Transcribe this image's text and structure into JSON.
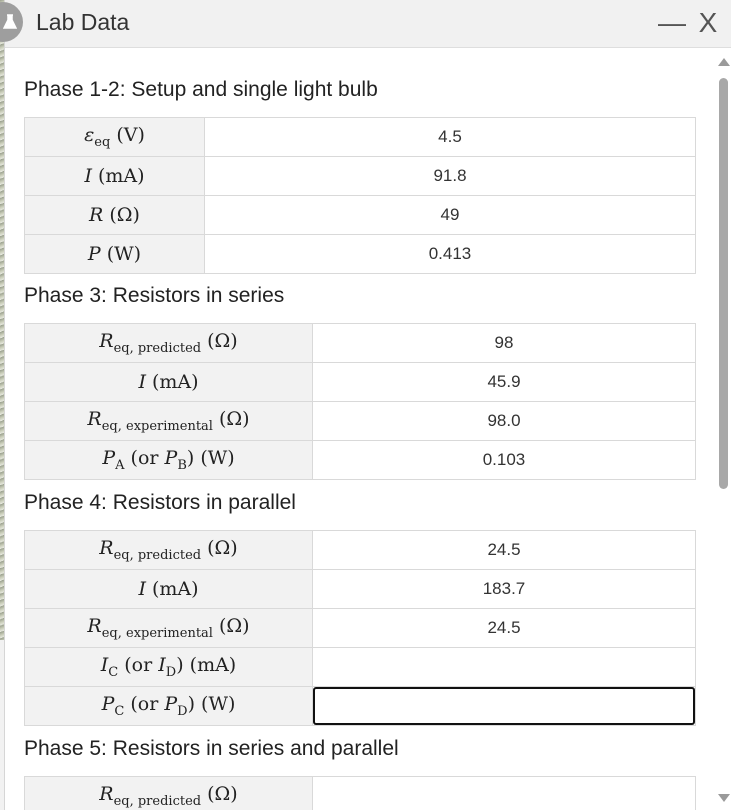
{
  "window": {
    "title": "Lab Data",
    "minimize_label": "—",
    "close_label": "X"
  },
  "sections": [
    {
      "title": "Phase 1-2: Setup and single light bulb",
      "rows": [
        {
          "label_main": "ε",
          "label_sub": "eq",
          "label_unit": " (V)",
          "value": "4.5"
        },
        {
          "label_main": "I",
          "label_sub": "",
          "label_unit": " (mA)",
          "value": "91.8"
        },
        {
          "label_main": "R",
          "label_sub": "",
          "label_unit": " (Ω)",
          "value": "49"
        },
        {
          "label_main": "P",
          "label_sub": "",
          "label_unit": " (W)",
          "value": "0.413"
        }
      ]
    },
    {
      "title": "Phase 3: Resistors in series",
      "rows": [
        {
          "label_main": "R",
          "label_sub": "eq, predicted",
          "label_unit": " (Ω)",
          "value": "98"
        },
        {
          "label_main": "I",
          "label_sub": "",
          "label_unit": " (mA)",
          "value": "45.9"
        },
        {
          "label_main": "R",
          "label_sub": "eq, experimental",
          "label_unit": " (Ω)",
          "value": "98.0"
        },
        {
          "label_main": "P",
          "label_sub": "A",
          "label_mid": " (or ",
          "label_main2": "P",
          "label_sub2": "B",
          "label_unit": ") (W)",
          "value": "0.103"
        }
      ]
    },
    {
      "title": "Phase 4: Resistors in parallel",
      "rows": [
        {
          "label_main": "R",
          "label_sub": "eq, predicted",
          "label_unit": " (Ω)",
          "value": "24.5"
        },
        {
          "label_main": "I",
          "label_sub": "",
          "label_unit": " (mA)",
          "value": "183.7"
        },
        {
          "label_main": "R",
          "label_sub": "eq, experimental",
          "label_unit": " (Ω)",
          "value": "24.5"
        },
        {
          "label_main": "I",
          "label_sub": "C",
          "label_mid": " (or ",
          "label_main2": "I",
          "label_sub2": "D",
          "label_unit": ") (mA)",
          "value": ""
        },
        {
          "label_main": "P",
          "label_sub": "C",
          "label_mid": " (or ",
          "label_main2": "P",
          "label_sub2": "D",
          "label_unit": ") (W)",
          "value": ""
        }
      ]
    },
    {
      "title": "Phase 5: Resistors in series and parallel",
      "rows": [
        {
          "label_main": "R",
          "label_sub": "eq, predicted",
          "label_unit": " (Ω)",
          "value": ""
        }
      ]
    }
  ]
}
